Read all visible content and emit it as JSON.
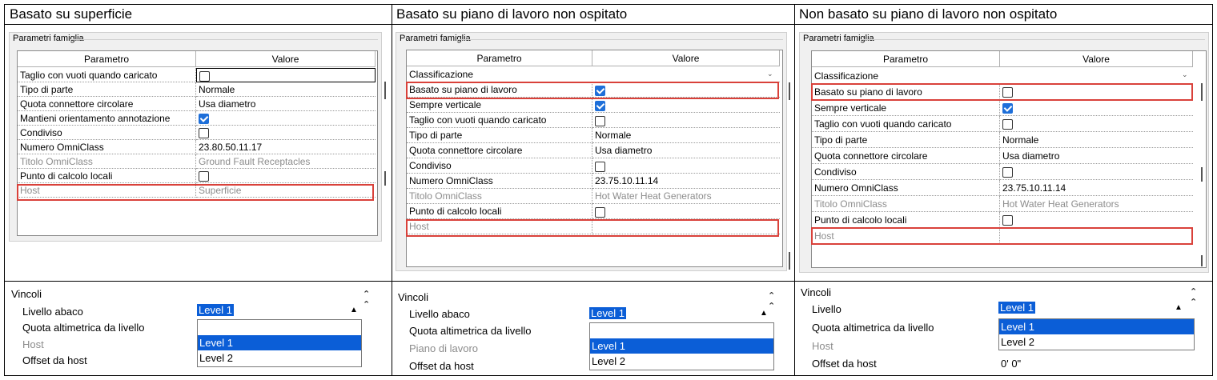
{
  "columns": [
    {
      "title": "Basato su superficie",
      "dialog_title": "Parametri famiglia",
      "header": {
        "param": "Parametro",
        "value": "Valore"
      },
      "rows": [
        {
          "name": "Taglio con vuoti quando caricato",
          "value": "",
          "check": "off"
        },
        {
          "name": "Tipo di parte",
          "value": "Normale"
        },
        {
          "name": "Quota connettore circolare",
          "value": "Usa diametro"
        },
        {
          "name": "Mantieni orientamento annotazione",
          "value": "",
          "check": "on"
        },
        {
          "name": "Condiviso",
          "value": "",
          "check": "off"
        },
        {
          "name": "Numero OmniClass",
          "value": "23.80.50.11.17"
        },
        {
          "name": "Titolo OmniClass",
          "value": "Ground Fault Receptacles",
          "grey": true
        },
        {
          "name": "Punto di calcolo locali",
          "value": "",
          "check": "off"
        },
        {
          "name": "Host",
          "value": "Superficie",
          "grey": true
        }
      ],
      "vincoli": {
        "header": "Vincoli",
        "props": [
          "Livello abaco",
          "Quota altimetrica da livello",
          "Host",
          "Offset da host"
        ],
        "selected": "Level 1",
        "options": [
          "Level 1",
          "Level 2"
        ]
      }
    },
    {
      "title": "Basato su piano di lavoro non ospitato",
      "dialog_title": "Parametri famiglia",
      "header": {
        "param": "Parametro",
        "value": "Valore"
      },
      "rows": [
        {
          "name": "Classificazione",
          "value": "",
          "section": true
        },
        {
          "name": "Basato su piano di lavoro",
          "value": "",
          "check": "on"
        },
        {
          "name": "Sempre verticale",
          "value": "",
          "check": "on"
        },
        {
          "name": "Taglio con vuoti quando caricato",
          "value": "",
          "check": "off"
        },
        {
          "name": "Tipo di parte",
          "value": "Normale"
        },
        {
          "name": "Quota connettore circolare",
          "value": "Usa diametro"
        },
        {
          "name": "Condiviso",
          "value": "",
          "check": "off"
        },
        {
          "name": "Numero OmniClass",
          "value": "23.75.10.11.14"
        },
        {
          "name": "Titolo OmniClass",
          "value": "Hot Water Heat Generators",
          "grey": true
        },
        {
          "name": "Punto di calcolo locali",
          "value": "",
          "check": "off"
        },
        {
          "name": "Host",
          "value": "",
          "grey": true
        }
      ],
      "vincoli": {
        "header": "Vincoli",
        "props": [
          "Livello abaco",
          "Quota altimetrica da livello",
          "Piano di lavoro",
          "Offset da host"
        ],
        "selected": "Level 1",
        "options": [
          "Level 1",
          "Level 2"
        ]
      }
    },
    {
      "title": "Non basato su piano di lavoro non ospitato",
      "dialog_title": "Parametri famiglia",
      "header": {
        "param": "Parametro",
        "value": "Valore"
      },
      "rows": [
        {
          "name": "Classificazione",
          "value": "",
          "section": true
        },
        {
          "name": "Basato su piano di lavoro",
          "value": "",
          "check": "off"
        },
        {
          "name": "Sempre verticale",
          "value": "",
          "check": "on"
        },
        {
          "name": "Taglio con vuoti quando caricato",
          "value": "",
          "check": "off"
        },
        {
          "name": "Tipo di parte",
          "value": "Normale"
        },
        {
          "name": "Quota connettore circolare",
          "value": "Usa diametro"
        },
        {
          "name": "Condiviso",
          "value": "",
          "check": "off"
        },
        {
          "name": "Numero OmniClass",
          "value": "23.75.10.11.14"
        },
        {
          "name": "Titolo OmniClass",
          "value": "Hot Water Heat Generators",
          "grey": true
        },
        {
          "name": "Punto di calcolo locali",
          "value": "",
          "check": "off"
        },
        {
          "name": "Host",
          "value": "",
          "grey": true
        }
      ],
      "vincoli": {
        "header": "Vincoli",
        "props": [
          "Livello",
          "Quota altimetrica da livello",
          "Host",
          "Offset da host"
        ],
        "selected": "Level 1",
        "options": [
          "Level 1",
          "Level 2"
        ],
        "offset_value": "0'  0\""
      }
    }
  ],
  "colors": {
    "highlight_box": "#d9413a",
    "selection": "#0b5ed7",
    "checkbox_on": "#1e6fd9"
  }
}
